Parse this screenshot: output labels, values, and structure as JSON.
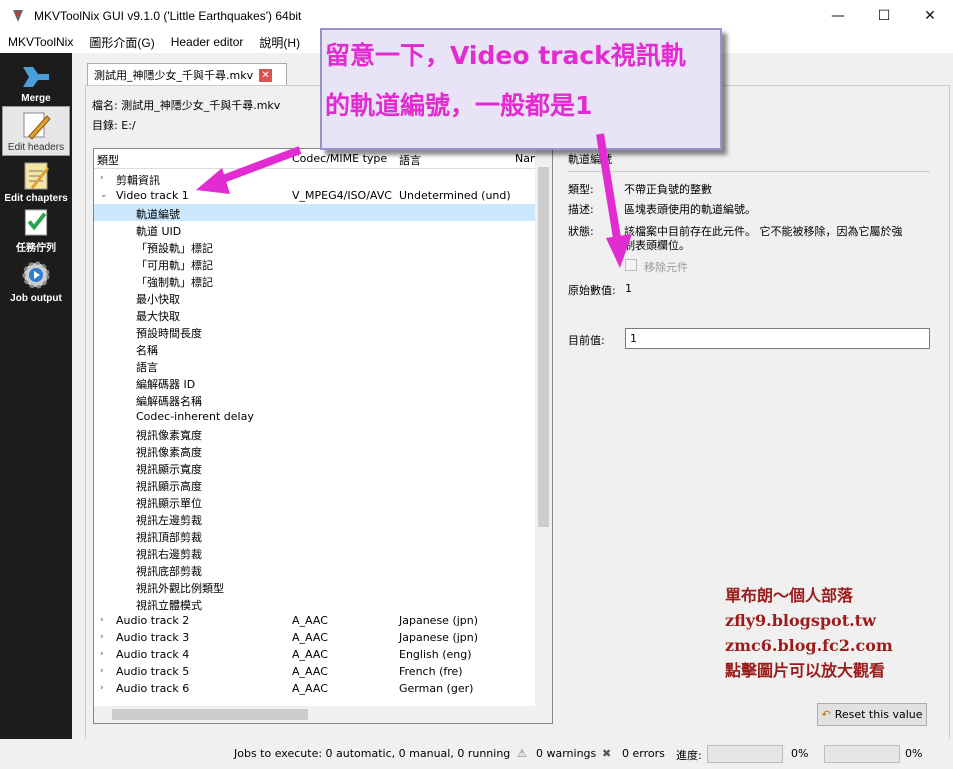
{
  "window": {
    "title": "MKVToolNix GUI v9.1.0 ('Little Earthquakes') 64bit",
    "min": "—",
    "max": "☐",
    "close": "✕"
  },
  "menu": [
    "MKVToolNix",
    "圖形介面(G)",
    "Header editor",
    "說明(H)"
  ],
  "sidebar": [
    {
      "label": "Merge",
      "icon": "merge-arrow-icon"
    },
    {
      "label": "Edit headers",
      "icon": "pencil-icon"
    },
    {
      "label": "Edit chapters",
      "icon": "notepad-icon"
    },
    {
      "label": "任務佇列",
      "icon": "checklist-icon"
    },
    {
      "label": "Job output",
      "icon": "gear-icon"
    }
  ],
  "tab": {
    "label": "測試用_神隱少女_千與千尋.mkv",
    "close": "✕"
  },
  "file": {
    "name_label": "檔名:",
    "name": "測試用_神隱少女_千與千尋.mkv",
    "dir_label": "目錄:",
    "dir": "E:/"
  },
  "tree": {
    "headers": [
      "類型",
      "Codec/MIME type",
      "語言",
      "Nan"
    ],
    "rows": [
      {
        "arrow": "›",
        "c1": "剪輯資訊",
        "c2": "",
        "c3": ""
      },
      {
        "arrow": "⌄",
        "c1": "Video track 1",
        "c2": "V_MPEG4/ISO/AVC",
        "c3": "Undetermined (und)"
      },
      {
        "arrow": "",
        "c1": "軌道編號",
        "c2": "",
        "c3": ""
      },
      {
        "arrow": "",
        "c1": "軌道 UID",
        "c2": "",
        "c3": ""
      },
      {
        "arrow": "",
        "c1": "「預設軌」標記",
        "c2": "",
        "c3": ""
      },
      {
        "arrow": "",
        "c1": "「可用軌」標記",
        "c2": "",
        "c3": ""
      },
      {
        "arrow": "",
        "c1": "「強制軌」標記",
        "c2": "",
        "c3": ""
      },
      {
        "arrow": "",
        "c1": "最小快取",
        "c2": "",
        "c3": ""
      },
      {
        "arrow": "",
        "c1": "最大快取",
        "c2": "",
        "c3": ""
      },
      {
        "arrow": "",
        "c1": "預設時間長度",
        "c2": "",
        "c3": ""
      },
      {
        "arrow": "",
        "c1": "名稱",
        "c2": "",
        "c3": ""
      },
      {
        "arrow": "",
        "c1": "語言",
        "c2": "",
        "c3": ""
      },
      {
        "arrow": "",
        "c1": "編解碼器 ID",
        "c2": "",
        "c3": ""
      },
      {
        "arrow": "",
        "c1": "編解碼器名稱",
        "c2": "",
        "c3": ""
      },
      {
        "arrow": "",
        "c1": "Codec-inherent delay",
        "c2": "",
        "c3": ""
      },
      {
        "arrow": "",
        "c1": "視訊像素寬度",
        "c2": "",
        "c3": ""
      },
      {
        "arrow": "",
        "c1": "視訊像素高度",
        "c2": "",
        "c3": ""
      },
      {
        "arrow": "",
        "c1": "視訊顯示寬度",
        "c2": "",
        "c3": ""
      },
      {
        "arrow": "",
        "c1": "視訊顯示高度",
        "c2": "",
        "c3": ""
      },
      {
        "arrow": "",
        "c1": "視訊顯示單位",
        "c2": "",
        "c3": ""
      },
      {
        "arrow": "",
        "c1": "視訊左邊剪裁",
        "c2": "",
        "c3": ""
      },
      {
        "arrow": "",
        "c1": "視訊頂部剪裁",
        "c2": "",
        "c3": ""
      },
      {
        "arrow": "",
        "c1": "視訊右邊剪裁",
        "c2": "",
        "c3": ""
      },
      {
        "arrow": "",
        "c1": "視訊底部剪裁",
        "c2": "",
        "c3": ""
      },
      {
        "arrow": "",
        "c1": "視訊外觀比例類型",
        "c2": "",
        "c3": ""
      },
      {
        "arrow": "",
        "c1": "視訊立體模式",
        "c2": "",
        "c3": ""
      },
      {
        "arrow": "›",
        "c1": "Audio track 2",
        "c2": "A_AAC",
        "c3": "Japanese (jpn)"
      },
      {
        "arrow": "›",
        "c1": "Audio track 3",
        "c2": "A_AAC",
        "c3": "Japanese (jpn)"
      },
      {
        "arrow": "›",
        "c1": "Audio track 4",
        "c2": "A_AAC",
        "c3": "English (eng)"
      },
      {
        "arrow": "›",
        "c1": "Audio track 5",
        "c2": "A_AAC",
        "c3": "French (fre)"
      },
      {
        "arrow": "›",
        "c1": "Audio track 6",
        "c2": "A_AAC",
        "c3": "German (ger)"
      }
    ]
  },
  "detail": {
    "heading": "軌道編號",
    "type_label": "類型:",
    "type": "不帶正負號的整數",
    "desc_label": "描述:",
    "desc": "區塊表頭使用的軌道編號。",
    "status_label": "狀態:",
    "status_1": "該檔案中目前存在此元件。 它不能被移除，因為它屬於強",
    "status_2": "制表頭欄位。",
    "remove_label": "移除元件",
    "orig_label": "原始數值:",
    "orig": "1",
    "cur_label": "目前值:",
    "cur": "1"
  },
  "reset_button": "Reset this value",
  "status": {
    "jobs": "Jobs to execute:  0 automatic, 0 manual, 0 running",
    "warnings": "0 warnings",
    "errors": "0 errors",
    "progress_label": "進度:",
    "progress_1": "0%",
    "progress_2": "0%"
  },
  "annotation": {
    "line1": "留意一下，Video track視訊軌",
    "line2": "的軌道編號，一般都是1",
    "color": "#e22bd1"
  },
  "blog": [
    "單布朗～個人部落",
    "zfly9.blogspot.tw",
    "zmc6.blog.fc2.com",
    "點擊圖片可以放大觀看"
  ]
}
